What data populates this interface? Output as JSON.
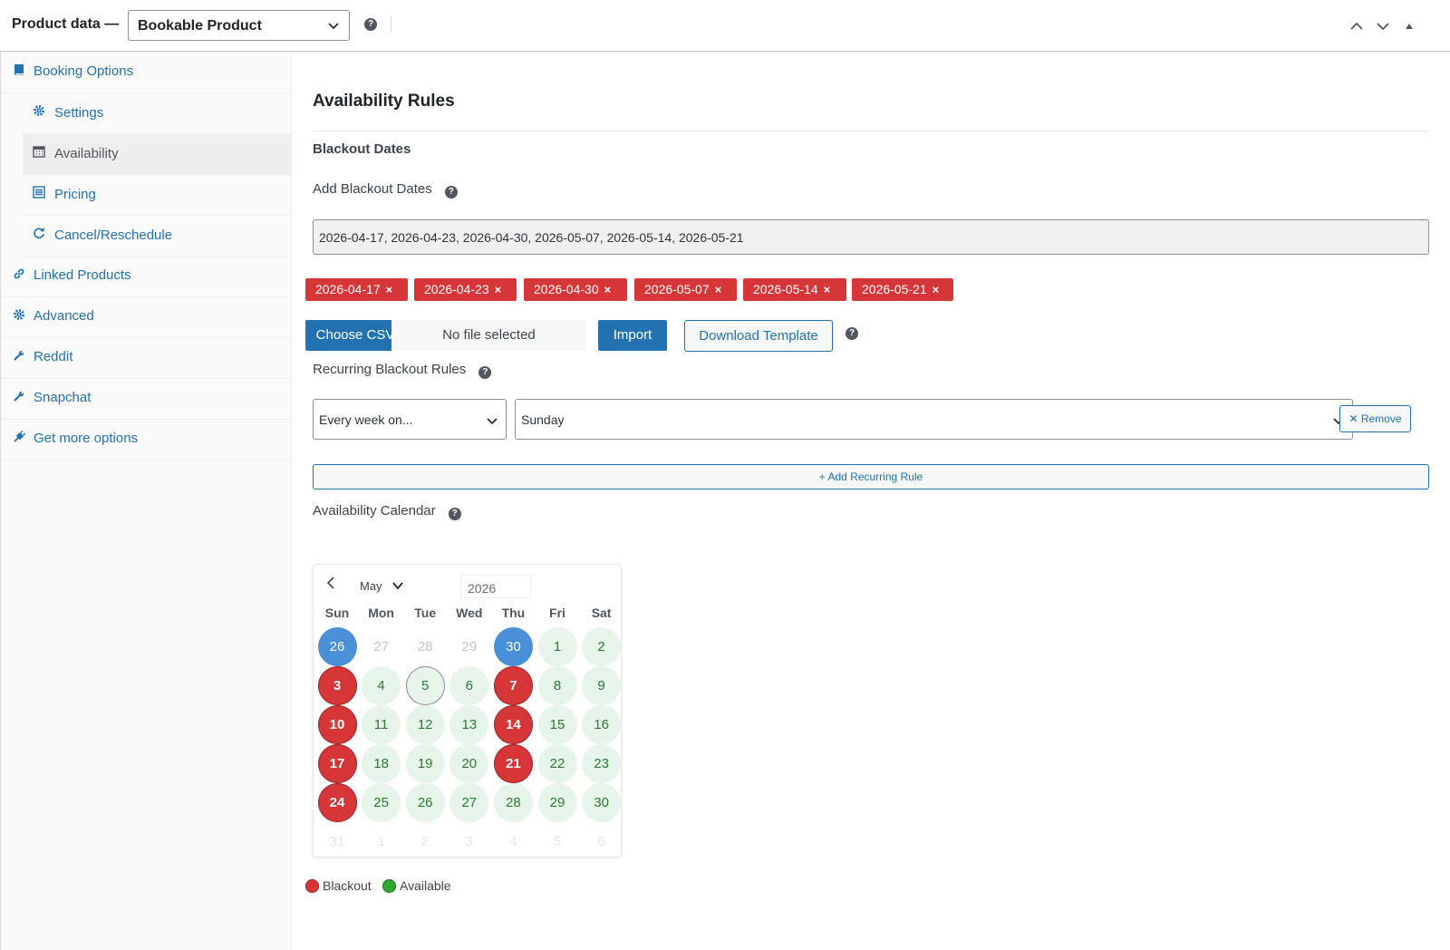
{
  "header": {
    "title": "Product data —",
    "product_type": "Bookable Product"
  },
  "sidebar": {
    "items": [
      {
        "label": "Booking Options",
        "icon": "book-icon"
      },
      {
        "label": "Settings",
        "icon": "gear-icon"
      },
      {
        "label": "Availability",
        "icon": "calendar-icon"
      },
      {
        "label": "Pricing",
        "icon": "list-icon"
      },
      {
        "label": "Cancel/Reschedule",
        "icon": "refresh-icon"
      },
      {
        "label": "Linked Products",
        "icon": "link-icon"
      },
      {
        "label": "Advanced",
        "icon": "gear-icon"
      },
      {
        "label": "Reddit",
        "icon": "wrench-icon"
      },
      {
        "label": "Snapchat",
        "icon": "wrench-icon"
      },
      {
        "label": "Get more options",
        "icon": "plugin-icon"
      }
    ]
  },
  "main": {
    "heading": "Availability Rules",
    "subheading": "Blackout Dates",
    "add_label": "Add Blackout Dates",
    "dates_value": "2026-04-17, 2026-04-23, 2026-04-30, 2026-05-07, 2026-05-14, 2026-05-21",
    "chips": [
      "2026-04-17",
      "2026-04-23",
      "2026-04-30",
      "2026-05-07",
      "2026-05-14",
      "2026-05-21"
    ],
    "chip_remove": "×",
    "choose_csv": "Choose CSV",
    "no_file": "No file selected",
    "import": "Import",
    "download_template": "Download Template",
    "recurring_label": "Recurring Blackout Rules",
    "recurring_frequency": "Every week on...",
    "recurring_day": "Sunday",
    "remove": "✕ Remove",
    "add_rule": "+ Add Recurring Rule",
    "calendar_label": "Availability Calendar"
  },
  "calendar": {
    "month": "May",
    "year": "2026",
    "weekdays": [
      "Sun",
      "Mon",
      "Tue",
      "Wed",
      "Thu",
      "Fri",
      "Sat"
    ],
    "weeks": [
      [
        {
          "d": "26",
          "s": "selected"
        },
        {
          "d": "27",
          "s": "other"
        },
        {
          "d": "28",
          "s": "other"
        },
        {
          "d": "29",
          "s": "other"
        },
        {
          "d": "30",
          "s": "selected"
        },
        {
          "d": "1",
          "s": "avail"
        },
        {
          "d": "2",
          "s": "avail"
        }
      ],
      [
        {
          "d": "3",
          "s": "blackout"
        },
        {
          "d": "4",
          "s": "avail"
        },
        {
          "d": "5",
          "s": "today"
        },
        {
          "d": "6",
          "s": "avail"
        },
        {
          "d": "7",
          "s": "blackout"
        },
        {
          "d": "8",
          "s": "avail"
        },
        {
          "d": "9",
          "s": "avail"
        }
      ],
      [
        {
          "d": "10",
          "s": "blackout"
        },
        {
          "d": "11",
          "s": "avail"
        },
        {
          "d": "12",
          "s": "avail"
        },
        {
          "d": "13",
          "s": "avail"
        },
        {
          "d": "14",
          "s": "blackout"
        },
        {
          "d": "15",
          "s": "avail"
        },
        {
          "d": "16",
          "s": "avail"
        }
      ],
      [
        {
          "d": "17",
          "s": "blackout"
        },
        {
          "d": "18",
          "s": "avail"
        },
        {
          "d": "19",
          "s": "avail"
        },
        {
          "d": "20",
          "s": "avail"
        },
        {
          "d": "21",
          "s": "blackout"
        },
        {
          "d": "22",
          "s": "avail"
        },
        {
          "d": "23",
          "s": "avail"
        }
      ],
      [
        {
          "d": "24",
          "s": "blackout"
        },
        {
          "d": "25",
          "s": "avail"
        },
        {
          "d": "26",
          "s": "avail"
        },
        {
          "d": "27",
          "s": "avail"
        },
        {
          "d": "28",
          "s": "avail"
        },
        {
          "d": "29",
          "s": "avail"
        },
        {
          "d": "30",
          "s": "avail"
        }
      ],
      [
        {
          "d": "31",
          "s": "next"
        },
        {
          "d": "1",
          "s": "next"
        },
        {
          "d": "2",
          "s": "next"
        },
        {
          "d": "3",
          "s": "next"
        },
        {
          "d": "4",
          "s": "next"
        },
        {
          "d": "5",
          "s": "next"
        },
        {
          "d": "6",
          "s": "next"
        }
      ]
    ]
  },
  "legend": {
    "blackout": "Blackout",
    "available": "Available",
    "blackout_color": "#d63638",
    "available_color": "#2ea82e"
  },
  "colors": {
    "accent": "#2271b1",
    "blackout": "#d63638",
    "selected": "#4a90d9",
    "available_bg": "#e6f4ea"
  }
}
